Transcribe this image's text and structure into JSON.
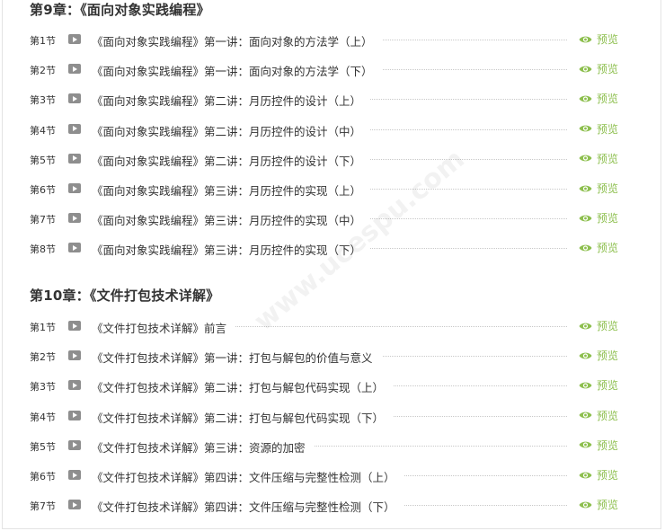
{
  "chapters": [
    {
      "title": "第9章：《面向对象实践编程》",
      "lessons": [
        {
          "no": "第1节",
          "title": "《面向对象实践编程》第一讲：面向对象的方法学（上）",
          "preview": "预览"
        },
        {
          "no": "第2节",
          "title": "《面向对象实践编程》第一讲：面向对象的方法学（下）",
          "preview": "预览"
        },
        {
          "no": "第3节",
          "title": "《面向对象实践编程》第二讲：月历控件的设计（上）",
          "preview": "预览"
        },
        {
          "no": "第4节",
          "title": "《面向对象实践编程》第二讲：月历控件的设计（中）",
          "preview": "预览"
        },
        {
          "no": "第5节",
          "title": "《面向对象实践编程》第二讲：月历控件的设计（下）",
          "preview": "预览"
        },
        {
          "no": "第6节",
          "title": "《面向对象实践编程》第三讲：月历控件的实现（上）",
          "preview": "预览"
        },
        {
          "no": "第7节",
          "title": "《面向对象实践编程》第三讲：月历控件的实现（中）",
          "preview": "预览"
        },
        {
          "no": "第8节",
          "title": "《面向对象实践编程》第三讲：月历控件的实现（下）",
          "preview": "预览"
        }
      ]
    },
    {
      "title": "第10章：《文件打包技术详解》",
      "lessons": [
        {
          "no": "第1节",
          "title": "《文件打包技术详解》前言",
          "preview": "预览"
        },
        {
          "no": "第2节",
          "title": "《文件打包技术详解》第一讲：打包与解包的价值与意义",
          "preview": "预览"
        },
        {
          "no": "第3节",
          "title": "《文件打包技术详解》第二讲：打包与解包代码实现（上）",
          "preview": "预览"
        },
        {
          "no": "第4节",
          "title": "《文件打包技术详解》第二讲：打包与解包代码实现（下）",
          "preview": "预览"
        },
        {
          "no": "第5节",
          "title": "《文件打包技术详解》第三讲：资源的加密",
          "preview": "预览"
        },
        {
          "no": "第6节",
          "title": "《文件打包技术详解》第四讲：文件压缩与完整性检测（上）",
          "preview": "预览"
        },
        {
          "no": "第7节",
          "title": "《文件打包技术详解》第四讲：文件压缩与完整性检测（下）",
          "preview": "预览"
        }
      ]
    }
  ],
  "watermark": "www.ucespu.com",
  "colors": {
    "preview_accent": "#8dbf4e",
    "play_icon": "#8e8e8e"
  },
  "icons": {
    "lesson": "play-video-icon",
    "preview": "eye-icon"
  }
}
